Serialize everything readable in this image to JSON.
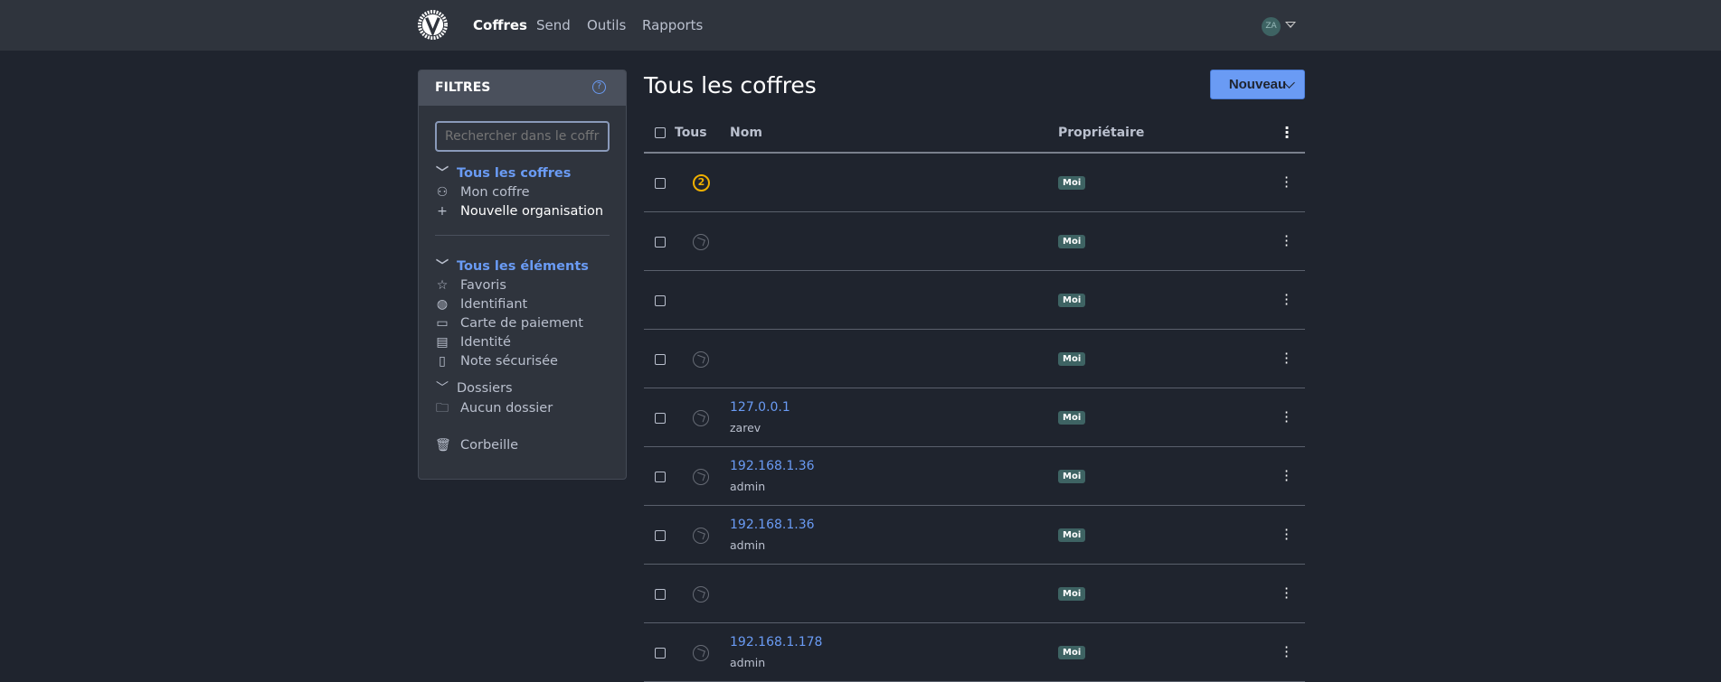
{
  "nav": {
    "links": [
      {
        "label": "Coffres",
        "active": true
      },
      {
        "label": "Send"
      },
      {
        "label": "Outils"
      },
      {
        "label": "Rapports"
      }
    ],
    "avatar": "ZA"
  },
  "sidebar": {
    "title": "FILTRES",
    "search_placeholder": "Rechercher dans le coffre",
    "vaults_header": "Tous les coffres",
    "my_vault": "Mon coffre",
    "new_org": "Nouvelle organisation",
    "items_header": "Tous les éléments",
    "types": [
      "Favoris",
      "Identifiant",
      "Carte de paiement",
      "Identité",
      "Note sécurisée"
    ],
    "folders_header": "Dossiers",
    "no_folder": "Aucun dossier",
    "trash": "Corbeille"
  },
  "main": {
    "title": "Tous les coffres",
    "new_button": "Nouveau",
    "columns": {
      "all": "Tous",
      "name": "Nom",
      "owner": "Propriétaire"
    },
    "rows": [
      {
        "icon": "number-2-icon",
        "count": "2",
        "name": "",
        "sub": "",
        "owner": "Moi"
      },
      {
        "icon": "globe-icon",
        "name": "",
        "sub": "",
        "owner": "Moi"
      },
      {
        "icon": "",
        "name": "",
        "sub": "",
        "owner": "Moi"
      },
      {
        "icon": "globe-icon",
        "name": "",
        "sub": "",
        "owner": "Moi"
      },
      {
        "icon": "globe-icon",
        "name": "127.0.0.1",
        "sub": "zarev",
        "owner": "Moi"
      },
      {
        "icon": "globe-icon",
        "name": "192.168.1.36",
        "sub": "admin",
        "owner": "Moi"
      },
      {
        "icon": "globe-icon",
        "name": "192.168.1.36",
        "sub": "admin",
        "owner": "Moi"
      },
      {
        "icon": "globe-icon",
        "name": "",
        "sub": "",
        "owner": "Moi"
      },
      {
        "icon": "globe-icon",
        "name": "192.168.1.178",
        "sub": "admin",
        "owner": "Moi"
      }
    ]
  },
  "colors": {
    "accent": "#6a9bf4",
    "badge": "#3e6363",
    "background": "#1f242e",
    "navbar": "#2f343d"
  }
}
